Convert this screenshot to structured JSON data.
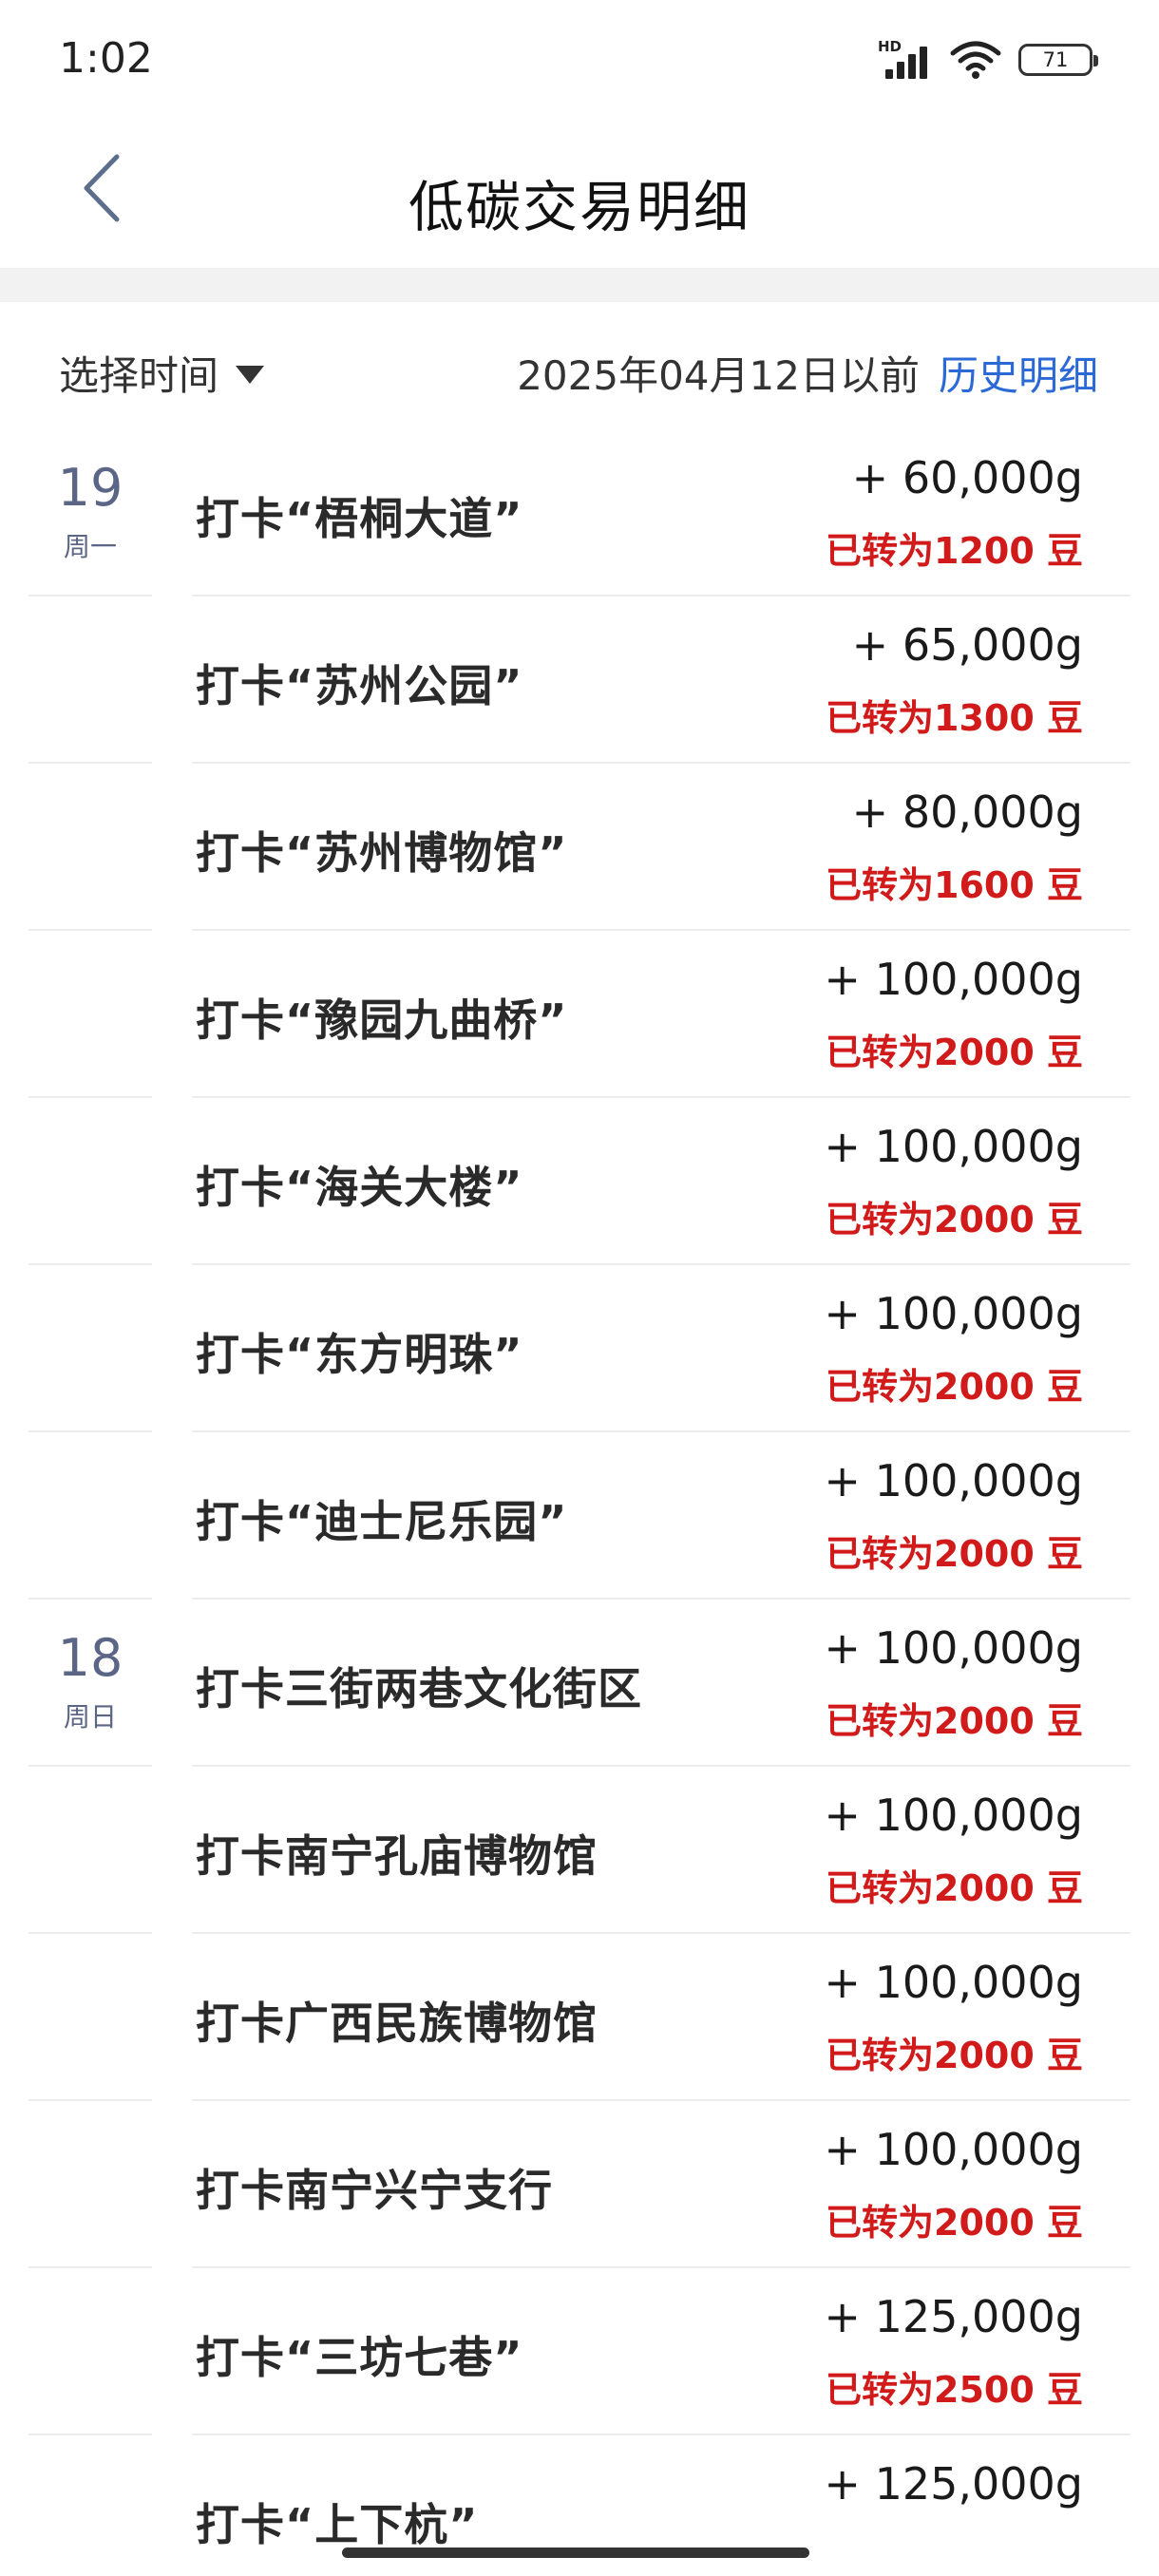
{
  "status": {
    "time": "1:02",
    "network_label": "HD",
    "battery": "71"
  },
  "header": {
    "title": "低碳交易明细",
    "back_icon": "chevron-left-icon"
  },
  "filter": {
    "select_label": "选择时间",
    "date_text": "2025年04月12日以前",
    "history_link": "历史明细"
  },
  "colors": {
    "accent_blue": "#2b69d6",
    "converted_red": "#d11a1a",
    "date_gray": "#5b6687"
  },
  "rows": [
    {
      "day": "19",
      "weekday": "周一",
      "title": "打卡“梧桐大道”",
      "amount": "+ 60,000g",
      "converted": "已转为1200 豆"
    },
    {
      "day": "",
      "weekday": "",
      "title": "打卡“苏州公园”",
      "amount": "+ 65,000g",
      "converted": "已转为1300 豆"
    },
    {
      "day": "",
      "weekday": "",
      "title": "打卡“苏州博物馆”",
      "amount": "+ 80,000g",
      "converted": "已转为1600 豆"
    },
    {
      "day": "",
      "weekday": "",
      "title": "打卡“豫园九曲桥”",
      "amount": "+ 100,000g",
      "converted": "已转为2000 豆"
    },
    {
      "day": "",
      "weekday": "",
      "title": "打卡“海关大楼”",
      "amount": "+ 100,000g",
      "converted": "已转为2000 豆"
    },
    {
      "day": "",
      "weekday": "",
      "title": "打卡“东方明珠”",
      "amount": "+ 100,000g",
      "converted": "已转为2000 豆"
    },
    {
      "day": "",
      "weekday": "",
      "title": "打卡“迪士尼乐园”",
      "amount": "+ 100,000g",
      "converted": "已转为2000 豆"
    },
    {
      "day": "18",
      "weekday": "周日",
      "title": "打卡三街两巷文化街区",
      "amount": "+ 100,000g",
      "converted": "已转为2000 豆"
    },
    {
      "day": "",
      "weekday": "",
      "title": "打卡南宁孔庙博物馆",
      "amount": "+ 100,000g",
      "converted": "已转为2000 豆"
    },
    {
      "day": "",
      "weekday": "",
      "title": "打卡广西民族博物馆",
      "amount": "+ 100,000g",
      "converted": "已转为2000 豆"
    },
    {
      "day": "",
      "weekday": "",
      "title": "打卡南宁兴宁支行",
      "amount": "+ 100,000g",
      "converted": "已转为2000 豆"
    },
    {
      "day": "",
      "weekday": "",
      "title": "打卡“三坊七巷”",
      "amount": "+ 125,000g",
      "converted": "已转为2500 豆"
    },
    {
      "day": "",
      "weekday": "",
      "title": "打卡“上下杭”",
      "amount": "+ 125,000g",
      "converted": ""
    }
  ]
}
